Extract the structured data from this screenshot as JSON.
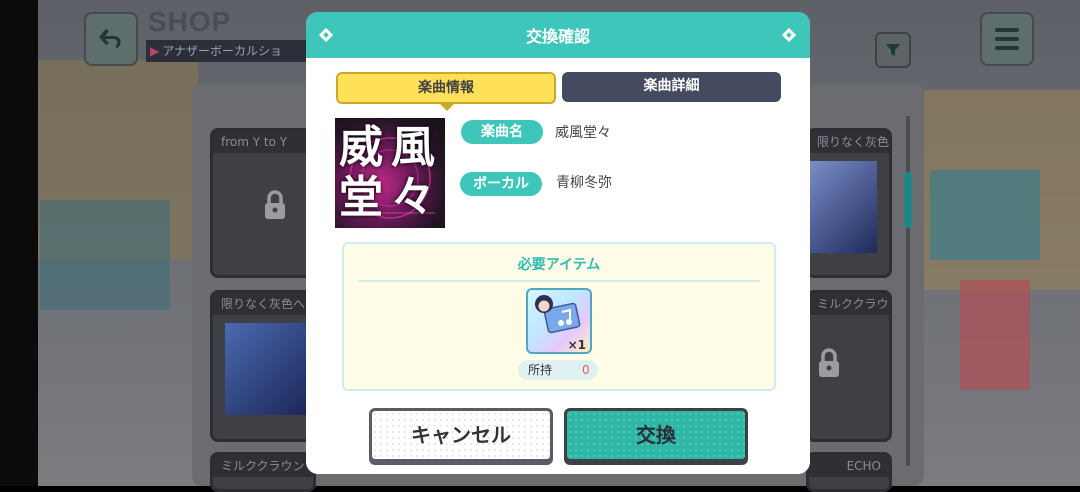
{
  "header": {
    "title": "SHOP",
    "subtitle": "アナザーボーカルショ"
  },
  "background_cards": [
    {
      "title": "from Y to Y",
      "locked": true
    },
    {
      "title": "限りなく灰色へ",
      "locked": false
    },
    {
      "title": "限りなく灰色へ",
      "locked": false
    },
    {
      "title": "ミルククラウン…",
      "locked": true
    },
    {
      "title": "ミルククラウン",
      "locked": false
    },
    {
      "title": "ECHO",
      "locked": false
    }
  ],
  "dialog": {
    "title": "交換確認",
    "tabs": [
      {
        "label": "楽曲情報",
        "active": true
      },
      {
        "label": "楽曲詳細",
        "active": false
      }
    ],
    "song": {
      "name_label": "楽曲名",
      "name": "威風堂々",
      "vocal_label": "ボーカル",
      "vocal": "青柳冬弥",
      "jacket_text": [
        "威",
        "風",
        "堂",
        "々"
      ]
    },
    "required": {
      "title": "必要アイテム",
      "item_count": "×1",
      "owned_label": "所持",
      "owned_value": "0"
    },
    "buttons": {
      "cancel": "キャンセル",
      "exchange": "交換"
    }
  },
  "colors": {
    "accent": "#3ec6ba",
    "tab_active": "#ffe159",
    "tab_inactive": "#444a60",
    "owned_zero": "#e8566b"
  }
}
